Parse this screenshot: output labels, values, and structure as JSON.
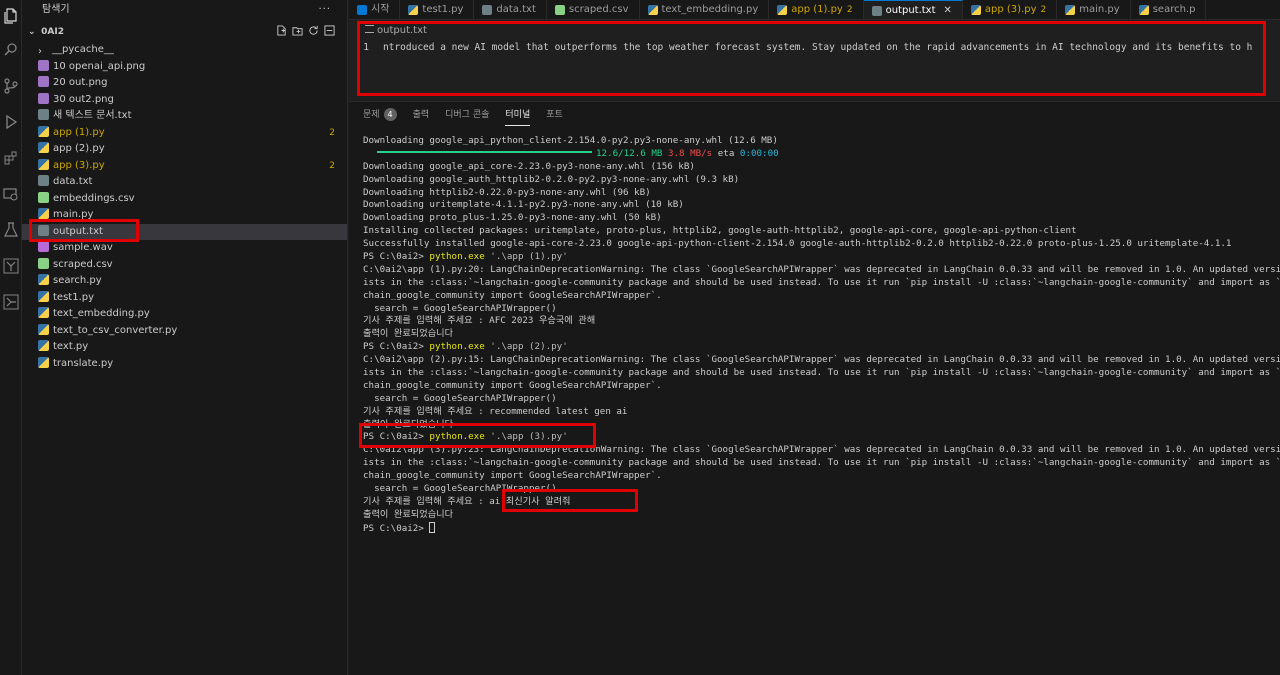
{
  "explorer": {
    "title": "탐색기",
    "more": "···",
    "folder": "0AI2",
    "items": [
      {
        "name": "__pycache__",
        "type": "folder",
        "badge": ""
      },
      {
        "name": "10 openai_api.png",
        "type": "png",
        "badge": ""
      },
      {
        "name": "20 out.png",
        "type": "png",
        "badge": ""
      },
      {
        "name": "30 out2.png",
        "type": "png",
        "badge": ""
      },
      {
        "name": "새 텍스트 문서.txt",
        "type": "txt",
        "badge": ""
      },
      {
        "name": "app (1).py",
        "type": "py",
        "badge": "2"
      },
      {
        "name": "app (2).py",
        "type": "py",
        "badge": ""
      },
      {
        "name": "app (3).py",
        "type": "py",
        "badge": "2"
      },
      {
        "name": "data.txt",
        "type": "txt",
        "badge": ""
      },
      {
        "name": "embeddings.csv",
        "type": "csv",
        "badge": ""
      },
      {
        "name": "main.py",
        "type": "py",
        "badge": ""
      },
      {
        "name": "output.txt",
        "type": "txt",
        "badge": ""
      },
      {
        "name": "sample.wav",
        "type": "wav",
        "badge": ""
      },
      {
        "name": "scraped.csv",
        "type": "csv",
        "badge": ""
      },
      {
        "name": "search.py",
        "type": "py",
        "badge": ""
      },
      {
        "name": "test1.py",
        "type": "py",
        "badge": ""
      },
      {
        "name": "text_embedding.py",
        "type": "py",
        "badge": ""
      },
      {
        "name": "text_to_csv_converter.py",
        "type": "py",
        "badge": ""
      },
      {
        "name": "text.py",
        "type": "py",
        "badge": ""
      },
      {
        "name": "translate.py",
        "type": "py",
        "badge": ""
      }
    ]
  },
  "tabs": [
    {
      "label": "시작",
      "badge": ""
    },
    {
      "label": "test1.py",
      "badge": ""
    },
    {
      "label": "data.txt",
      "badge": ""
    },
    {
      "label": "scraped.csv",
      "badge": ""
    },
    {
      "label": "text_embedding.py",
      "badge": ""
    },
    {
      "label": "app (1).py",
      "badge": "2"
    },
    {
      "label": "output.txt",
      "badge": ""
    },
    {
      "label": "app (3).py",
      "badge": "2"
    },
    {
      "label": "main.py",
      "badge": ""
    },
    {
      "label": "search.p",
      "badge": ""
    }
  ],
  "editor": {
    "breadcrumb": "output.txt",
    "line_number": "1",
    "line_text": "ntroduced a new AI model that outperforms the top weather forecast system. Stay updated on the rapid advancements in AI technology and its benefits to h"
  },
  "panel": {
    "tabs": [
      {
        "label": "문제",
        "count": "4"
      },
      {
        "label": "출력",
        "count": ""
      },
      {
        "label": "디버그 콘솔",
        "count": ""
      },
      {
        "label": "터미널",
        "count": ""
      },
      {
        "label": "포트",
        "count": ""
      }
    ]
  },
  "terminal": {
    "download_main": "Downloading google_api_python_client-2.154.0-py2.py3-none-any.whl (12.6 MB)",
    "progress_size": "12.6/12.6 MB",
    "progress_speed": "3.8 MB/s",
    "progress_eta_label": "eta",
    "progress_eta": "0:00:00",
    "downloads": [
      "Downloading google_api_core-2.23.0-py3-none-any.whl (156 kB)",
      "Downloading google_auth_httplib2-0.2.0-py2.py3-none-any.whl (9.3 kB)",
      "Downloading httplib2-0.22.0-py3-none-any.whl (96 kB)",
      "Downloading uritemplate-4.1.1-py2.py3-none-any.whl (10 kB)",
      "Downloading proto_plus-1.25.0-py3-none-any.whl (50 kB)",
      "Installing collected packages: uritemplate, proto-plus, httplib2, google-auth-httplib2, google-api-core, google-api-python-client",
      "Successfully installed google-api-core-2.23.0 google-api-python-client-2.154.0 google-auth-httplib2-0.2.0 httplib2-0.22.0 proto-plus-1.25.0 uritemplate-4.1.1"
    ],
    "prompt": "PS C:\\0ai2>",
    "cmd_python": "python.exe",
    "run1_arg": "'.\\app (1).py'",
    "run1_warn": [
      "C:\\0ai2\\app (1).py:20: LangChainDeprecationWarning: The class `GoogleSearchAPIWrapper` was deprecated in LangChain 0.0.33 and will be removed in 1.0. An updated version of th",
      "ists in the :class:`~langchain-google-community package and should be used instead. To use it run `pip install -U :class:`~langchain-google-community` and import as `from :c",
      "chain_google_community import GoogleSearchAPIWrapper`.",
      "  search = GoogleSearchAPIWrapper()"
    ],
    "run1_ask": "기사 주제를 입력해 주세요 : AFC 2023 우승국에 관해",
    "done1": "출력이 완료되었습니다",
    "run2_arg": "'.\\app (2).py'",
    "run2_warn": [
      "C:\\0ai2\\app (2).py:15: LangChainDeprecationWarning: The class `GoogleSearchAPIWrapper` was deprecated in LangChain 0.0.33 and will be removed in 1.0. An updated version of th",
      "ists in the :class:`~langchain-google-community package and should be used instead. To use it run `pip install -U :class:`~langchain-google-community` and import as `from :cl",
      "chain_google_community import GoogleSearchAPIWrapper`.",
      "  search = GoogleSearchAPIWrapper()"
    ],
    "run2_ask": "기사 주제를 입력해 주세요 : recommended latest gen ai",
    "done2": "출력이 완료되었습니다",
    "run3_arg": "'.\\app (3).py'",
    "run3_warn": [
      "C:\\0ai2\\app (3).py:23: LangChainDeprecationWarning: The class `GoogleSearchAPIWrapper` was deprecated in LangChain 0.0.33 and will be removed in 1.0. An updated version of th",
      "ists in the :class:`~langchain-google-community package and should be used instead. To use it run `pip install -U :class:`~langchain-google-community` and import as `from :cl",
      "chain_google_community import GoogleSearchAPIWrapper`.",
      "  search = GoogleSearchAPIWrapper()"
    ],
    "run3_ask_label": "기사 주제를 입력해 주세요 :",
    "run3_ask_value": "ai 최신기사 알려줘",
    "done3": "출력이 완료되었습니다"
  },
  "colors": {
    "accent": "#0078d4",
    "highlight_red": "#e00000",
    "terminal_green": "#23d18b",
    "terminal_yellow": "#e5e510",
    "warning_yellow": "#cca700"
  }
}
